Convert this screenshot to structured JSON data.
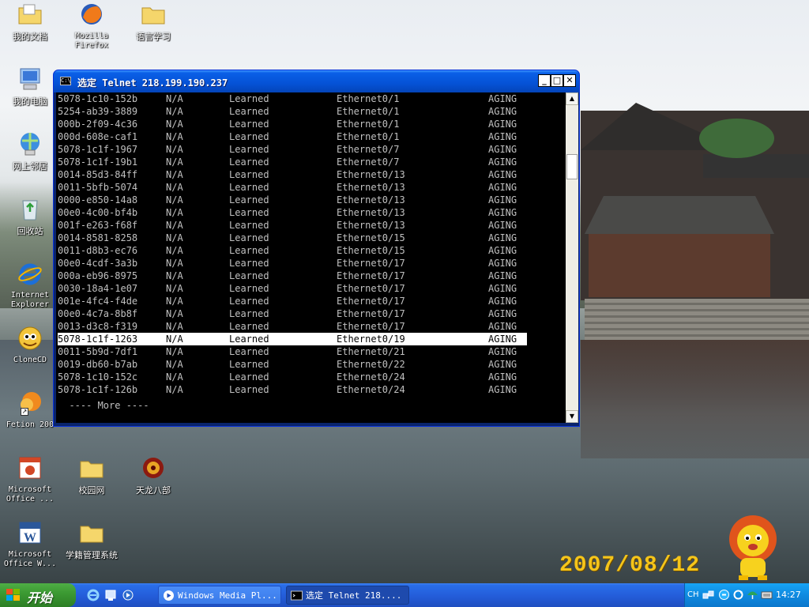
{
  "desktop": {
    "wallpaper_date": "2007/08/12",
    "icons": [
      {
        "label": "我的文档"
      },
      {
        "label": "Mozilla Firefox"
      },
      {
        "label": "语言学习"
      },
      {
        "label": "我的电脑"
      },
      {
        "label": "网上邻居"
      },
      {
        "label": "回收站"
      },
      {
        "label": "Internet Explorer"
      },
      {
        "label": "CloneCD"
      },
      {
        "label": "Fetion 200"
      },
      {
        "label": "Microsoft Office ..."
      },
      {
        "label": "校园网"
      },
      {
        "label": "天龙八部"
      },
      {
        "label": "Microsoft Office W..."
      },
      {
        "label": "学籍管理系统"
      }
    ]
  },
  "window": {
    "icon_text": "C:\\",
    "title": "选定 Telnet 218.199.190.237",
    "minimize": "_",
    "maximize": "□",
    "close": "✕",
    "rows": [
      {
        "mac": "5078-1c10-152b",
        "vlan": "N/A",
        "type": "Learned",
        "port": "Ethernet0/1",
        "state": "AGING"
      },
      {
        "mac": "5254-ab39-3889",
        "vlan": "N/A",
        "type": "Learned",
        "port": "Ethernet0/1",
        "state": "AGING"
      },
      {
        "mac": "000b-2f09-4c36",
        "vlan": "N/A",
        "type": "Learned",
        "port": "Ethernet0/1",
        "state": "AGING"
      },
      {
        "mac": "000d-608e-caf1",
        "vlan": "N/A",
        "type": "Learned",
        "port": "Ethernet0/1",
        "state": "AGING"
      },
      {
        "mac": "5078-1c1f-1967",
        "vlan": "N/A",
        "type": "Learned",
        "port": "Ethernet0/7",
        "state": "AGING"
      },
      {
        "mac": "5078-1c1f-19b1",
        "vlan": "N/A",
        "type": "Learned",
        "port": "Ethernet0/7",
        "state": "AGING"
      },
      {
        "mac": "0014-85d3-84ff",
        "vlan": "N/A",
        "type": "Learned",
        "port": "Ethernet0/13",
        "state": "AGING"
      },
      {
        "mac": "0011-5bfb-5074",
        "vlan": "N/A",
        "type": "Learned",
        "port": "Ethernet0/13",
        "state": "AGING"
      },
      {
        "mac": "0000-e850-14a8",
        "vlan": "N/A",
        "type": "Learned",
        "port": "Ethernet0/13",
        "state": "AGING"
      },
      {
        "mac": "00e0-4c00-bf4b",
        "vlan": "N/A",
        "type": "Learned",
        "port": "Ethernet0/13",
        "state": "AGING"
      },
      {
        "mac": "001f-e263-f68f",
        "vlan": "N/A",
        "type": "Learned",
        "port": "Ethernet0/13",
        "state": "AGING"
      },
      {
        "mac": "0014-8581-8258",
        "vlan": "N/A",
        "type": "Learned",
        "port": "Ethernet0/15",
        "state": "AGING"
      },
      {
        "mac": "0011-d8b3-ec76",
        "vlan": "N/A",
        "type": "Learned",
        "port": "Ethernet0/15",
        "state": "AGING"
      },
      {
        "mac": "00e0-4cdf-3a3b",
        "vlan": "N/A",
        "type": "Learned",
        "port": "Ethernet0/17",
        "state": "AGING"
      },
      {
        "mac": "000a-eb96-8975",
        "vlan": "N/A",
        "type": "Learned",
        "port": "Ethernet0/17",
        "state": "AGING"
      },
      {
        "mac": "0030-18a4-1e07",
        "vlan": "N/A",
        "type": "Learned",
        "port": "Ethernet0/17",
        "state": "AGING"
      },
      {
        "mac": "001e-4fc4-f4de",
        "vlan": "N/A",
        "type": "Learned",
        "port": "Ethernet0/17",
        "state": "AGING"
      },
      {
        "mac": "00e0-4c7a-8b8f",
        "vlan": "N/A",
        "type": "Learned",
        "port": "Ethernet0/17",
        "state": "AGING"
      },
      {
        "mac": "0013-d3c8-f319",
        "vlan": "N/A",
        "type": "Learned",
        "port": "Ethernet0/17",
        "state": "AGING"
      },
      {
        "mac": "5078-1c1f-1263",
        "vlan": "N/A",
        "type": "Learned",
        "port": "Ethernet0/19",
        "state": "AGING",
        "selected": true
      },
      {
        "mac": "0011-5b9d-7df1",
        "vlan": "N/A",
        "type": "Learned",
        "port": "Ethernet0/21",
        "state": "AGING"
      },
      {
        "mac": "0019-db60-b7ab",
        "vlan": "N/A",
        "type": "Learned",
        "port": "Ethernet0/22",
        "state": "AGING"
      },
      {
        "mac": "5078-1c10-152c",
        "vlan": "N/A",
        "type": "Learned",
        "port": "Ethernet0/24",
        "state": "AGING"
      },
      {
        "mac": "5078-1c1f-126b",
        "vlan": "N/A",
        "type": "Learned",
        "port": "Ethernet0/24",
        "state": "AGING"
      }
    ],
    "more_prompt": "  ---- More ----"
  },
  "taskbar": {
    "start_label": "开始",
    "tasks": [
      {
        "label": "Windows Media Pl..."
      },
      {
        "label": "选定 Telnet 218...."
      }
    ],
    "tray_language": "CH",
    "clock": "14:27"
  },
  "colors": {
    "terminal_bg": "#000000",
    "terminal_fg": "#c0c0c0",
    "selection_bg": "#ffffff",
    "titlebar": "#0552d6",
    "taskbar": "#245edb",
    "start_button": "#3c9a33",
    "wallpaper_date": "#f5c51a"
  }
}
